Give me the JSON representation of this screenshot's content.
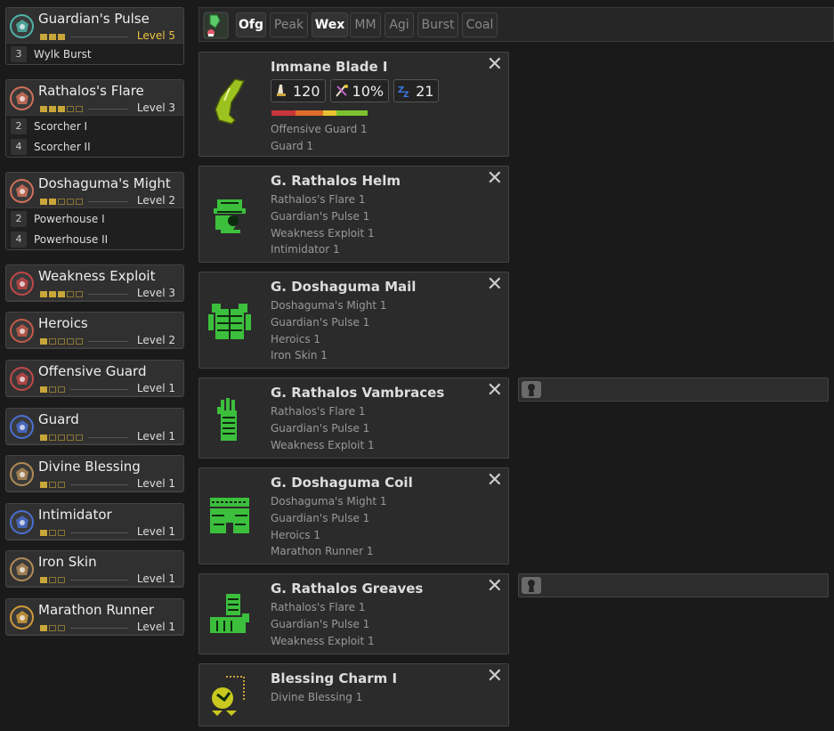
{
  "skills": [
    {
      "name": "Guardian's Pulse",
      "level": "Level 5",
      "filled": 3,
      "total": 3,
      "highlight": true,
      "icon": "guardian-pulse-icon",
      "color": "#4fb3a8",
      "bonuses": [
        {
          "n": "3",
          "label": "Wylk Burst"
        }
      ]
    },
    {
      "name": "Rathalos's Flare",
      "level": "Level 3",
      "filled": 3,
      "total": 5,
      "highlight": false,
      "icon": "rathalos-flare-icon",
      "color": "#d0705a",
      "bonuses": [
        {
          "n": "2",
          "label": "Scorcher I"
        },
        {
          "n": "4",
          "label": "Scorcher II"
        }
      ]
    },
    {
      "name": "Doshaguma's Might",
      "level": "Level 2",
      "filled": 2,
      "total": 5,
      "highlight": false,
      "icon": "doshaguma-might-icon",
      "color": "#d0705a",
      "bonuses": [
        {
          "n": "2",
          "label": "Powerhouse I"
        },
        {
          "n": "4",
          "label": "Powerhouse II"
        }
      ]
    },
    {
      "name": "Weakness Exploit",
      "level": "Level 3",
      "filled": 3,
      "total": 5,
      "highlight": false,
      "icon": "weakness-exploit-icon",
      "color": "#c04848",
      "bonuses": []
    },
    {
      "name": "Heroics",
      "level": "Level 2",
      "filled": 1,
      "total": 5,
      "highlight": false,
      "icon": "heroics-icon",
      "color": "#c25a4a",
      "bonuses": []
    },
    {
      "name": "Offensive Guard",
      "level": "Level 1",
      "filled": 1,
      "total": 3,
      "highlight": false,
      "icon": "offensive-guard-icon",
      "color": "#c04848",
      "bonuses": []
    },
    {
      "name": "Guard",
      "level": "Level 1",
      "filled": 1,
      "total": 5,
      "highlight": false,
      "icon": "guard-icon",
      "color": "#4a6fd0",
      "bonuses": []
    },
    {
      "name": "Divine Blessing",
      "level": "Level 1",
      "filled": 1,
      "total": 3,
      "highlight": false,
      "icon": "divine-blessing-icon",
      "color": "#b08a56",
      "bonuses": []
    },
    {
      "name": "Intimidator",
      "level": "Level 1",
      "filled": 1,
      "total": 3,
      "highlight": false,
      "icon": "intimidator-icon",
      "color": "#4a6fd0",
      "bonuses": []
    },
    {
      "name": "Iron Skin",
      "level": "Level 1",
      "filled": 1,
      "total": 3,
      "highlight": false,
      "icon": "iron-skin-icon",
      "color": "#b08a56",
      "bonuses": []
    },
    {
      "name": "Marathon Runner",
      "level": "Level 1",
      "filled": 1,
      "total": 3,
      "highlight": false,
      "icon": "marathon-runner-icon",
      "color": "#d09a3a",
      "bonuses": []
    }
  ],
  "filters": [
    {
      "label": "Ofg",
      "active": true
    },
    {
      "label": "Peak",
      "active": false
    },
    {
      "label": "Wex",
      "active": true
    },
    {
      "label": "MM",
      "active": false
    },
    {
      "label": "Agi",
      "active": false
    },
    {
      "label": "Burst",
      "active": false
    },
    {
      "label": "Coal",
      "active": false
    }
  ],
  "weapon": {
    "name": "Immane Blade I",
    "attack": "120",
    "affinity": "10%",
    "element": "21",
    "sharpness": [
      {
        "color": "#c8353a",
        "f": 0.25
      },
      {
        "color": "#e06b2a",
        "f": 0.29
      },
      {
        "color": "#e8c232",
        "f": 0.14
      },
      {
        "color": "#7cc32e",
        "f": 0.32
      }
    ],
    "skills": [
      "Offensive Guard 1",
      "Guard 1"
    ]
  },
  "armor": [
    {
      "name": "G. Rathalos Helm",
      "icon": "helm-icon",
      "skills": [
        "Rathalos's Flare 1",
        "Guardian's Pulse 1",
        "Weakness Exploit 1",
        "Intimidator 1"
      ],
      "slot": false
    },
    {
      "name": "G. Doshaguma Mail",
      "icon": "chest-mail-icon",
      "skills": [
        "Doshaguma's Might 1",
        "Guardian's Pulse 1",
        "Heroics 1",
        "Iron Skin 1"
      ],
      "slot": false
    },
    {
      "name": "G. Rathalos Vambraces",
      "icon": "vambraces-icon",
      "skills": [
        "Rathalos's Flare 1",
        "Guardian's Pulse 1",
        "Weakness Exploit 1"
      ],
      "slot": true
    },
    {
      "name": "G. Doshaguma Coil",
      "icon": "coil-icon",
      "skills": [
        "Doshaguma's Might 1",
        "Guardian's Pulse 1",
        "Heroics 1",
        "Marathon Runner 1"
      ],
      "slot": false
    },
    {
      "name": "G. Rathalos Greaves",
      "icon": "greaves-icon",
      "skills": [
        "Rathalos's Flare 1",
        "Guardian's Pulse 1",
        "Weakness Exploit 1"
      ],
      "slot": true
    },
    {
      "name": "Blessing Charm I",
      "icon": "charm-icon",
      "skills": [
        "Divine Blessing 1"
      ],
      "slot": false
    }
  ],
  "close_glyph": "✕",
  "colors": {
    "armor_green": "#3cbf3c",
    "accent_gold": "#f0c040",
    "weapon_green": "#9cc21f"
  }
}
